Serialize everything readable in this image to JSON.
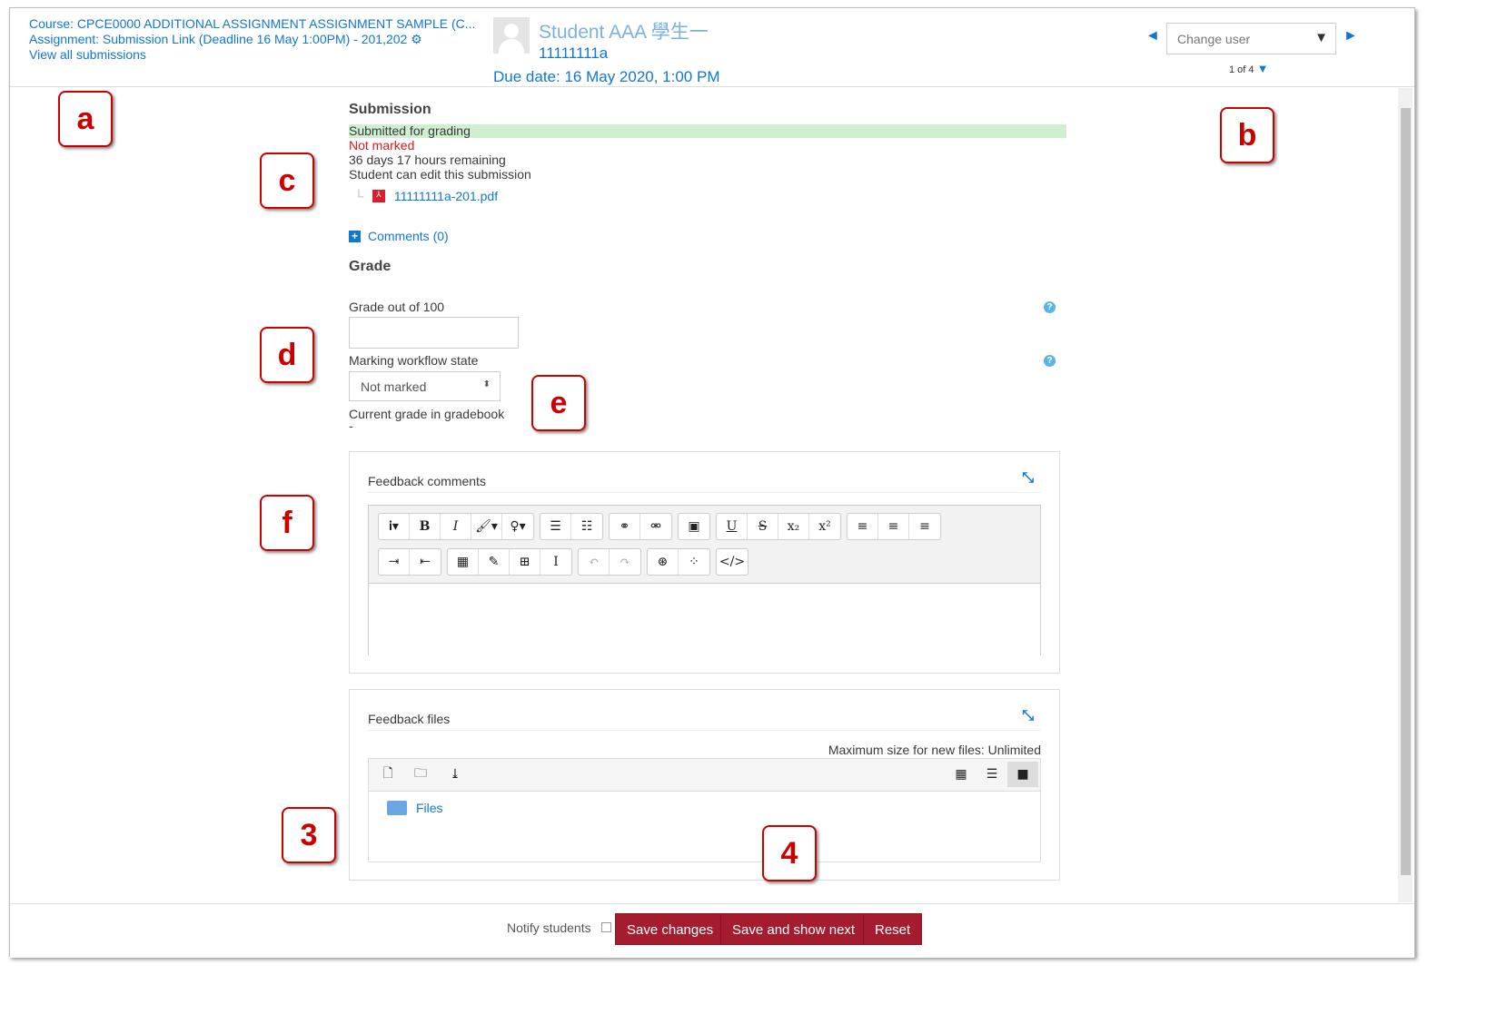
{
  "header": {
    "course": "Course: CPCE0000 ADDITIONAL ASSIGNMENT ASSIGNMENT SAMPLE (C...",
    "assignment": "Assignment: Submission Link (Deadline 16 May 1:00PM) - 201,202",
    "view_all": "View all submissions",
    "student_name": "Student AAA 學生一",
    "student_id": "11111111a",
    "due_date": "Due date: 16 May 2020, 1:00 PM",
    "change_user_placeholder": "Change user",
    "count": "1 of 4"
  },
  "submission": {
    "heading": "Submission",
    "status": "Submitted for grading",
    "grading_status": "Not marked",
    "time_remaining": "36 days 17 hours remaining",
    "edit_note": "Student can edit this submission",
    "file": "11111111a-201.pdf",
    "comments": "Comments (0)"
  },
  "grade": {
    "heading": "Grade",
    "grade_label": "Grade out of 100",
    "grade_value": "",
    "workflow_label": "Marking workflow state",
    "workflow_value": "Not marked",
    "current_label": "Current grade in gradebook",
    "current_value": "-"
  },
  "feedback_comments": {
    "label": "Feedback comments",
    "text": ""
  },
  "feedback_files": {
    "label": "Feedback files",
    "max_size": "Maximum size for new files: Unlimited",
    "folder": "Files"
  },
  "footer": {
    "notify": "Notify students",
    "save": "Save changes",
    "save_next": "Save and show next",
    "reset": "Reset"
  },
  "callouts": [
    "a",
    "b",
    "c",
    "d",
    "e",
    "f",
    "3",
    "4"
  ],
  "colors": {
    "link": "#1177d1",
    "primary_button": "#a51c2f",
    "submitted_bg": "#cfefcf",
    "not_marked": "#e0171c",
    "callout": "#cc0000"
  }
}
